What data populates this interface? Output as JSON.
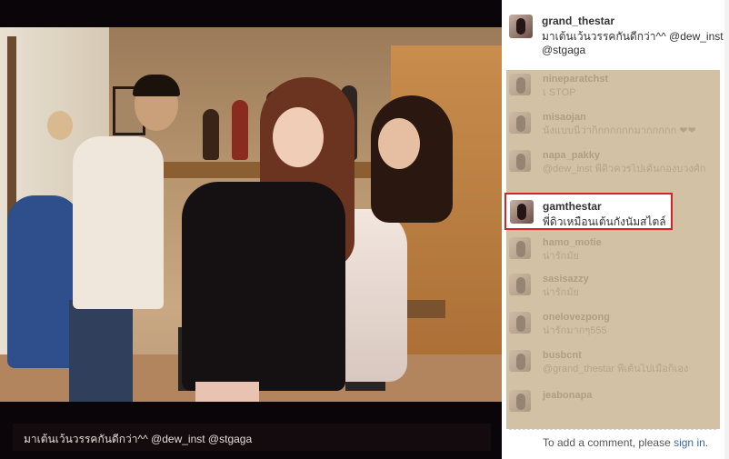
{
  "photo": {
    "caption": "มาเต้นเว้นวรรคกันดีกว่า^^ @dew_inst @stgaga"
  },
  "post": {
    "username": "grand_thestar",
    "caption": "มาเต้นเว้นวรรคกันดีกว่า^^ @dew_inst @stgaga"
  },
  "comments": [
    {
      "username": "nineparatchst",
      "text": "เ STOP"
    },
    {
      "username": "misaojan",
      "text": "นั่งแบบนี้ว่าก็กกกกกกมากกกกก ❤❤"
    },
    {
      "username": "napa_pakky",
      "text": "@dew_inst พี่ดิวควรไปเต้นกองบวงศ์ก"
    },
    {
      "username": "gamthestar",
      "text": "พี่ดิวเหมือนเต้นกังนัมสไตล์"
    },
    {
      "username": "hamo_motie",
      "text": "น่ารักมั้ย"
    },
    {
      "username": "sasisazzy",
      "text": "น่ารักมั้ย"
    },
    {
      "username": "onelovezpong",
      "text": "น่ารักมากๆ555"
    },
    {
      "username": "busbcnt",
      "text": "@grand_thestar พี่เต้นไปเมื่อก็เอง"
    },
    {
      "username": "jeabonapa",
      "text": ""
    }
  ],
  "highlighted_comment": {
    "username": "gamthestar",
    "text": "พี่ดิวเหมือนเต้นกังนัมสไตล์"
  },
  "signin": {
    "prefix": "To add a comment, please ",
    "link": "sign in",
    "suffix": "."
  },
  "colors": {
    "highlight_border": "#d6232a",
    "link": "#3b6aa0",
    "mask": "#d3c1a6"
  }
}
